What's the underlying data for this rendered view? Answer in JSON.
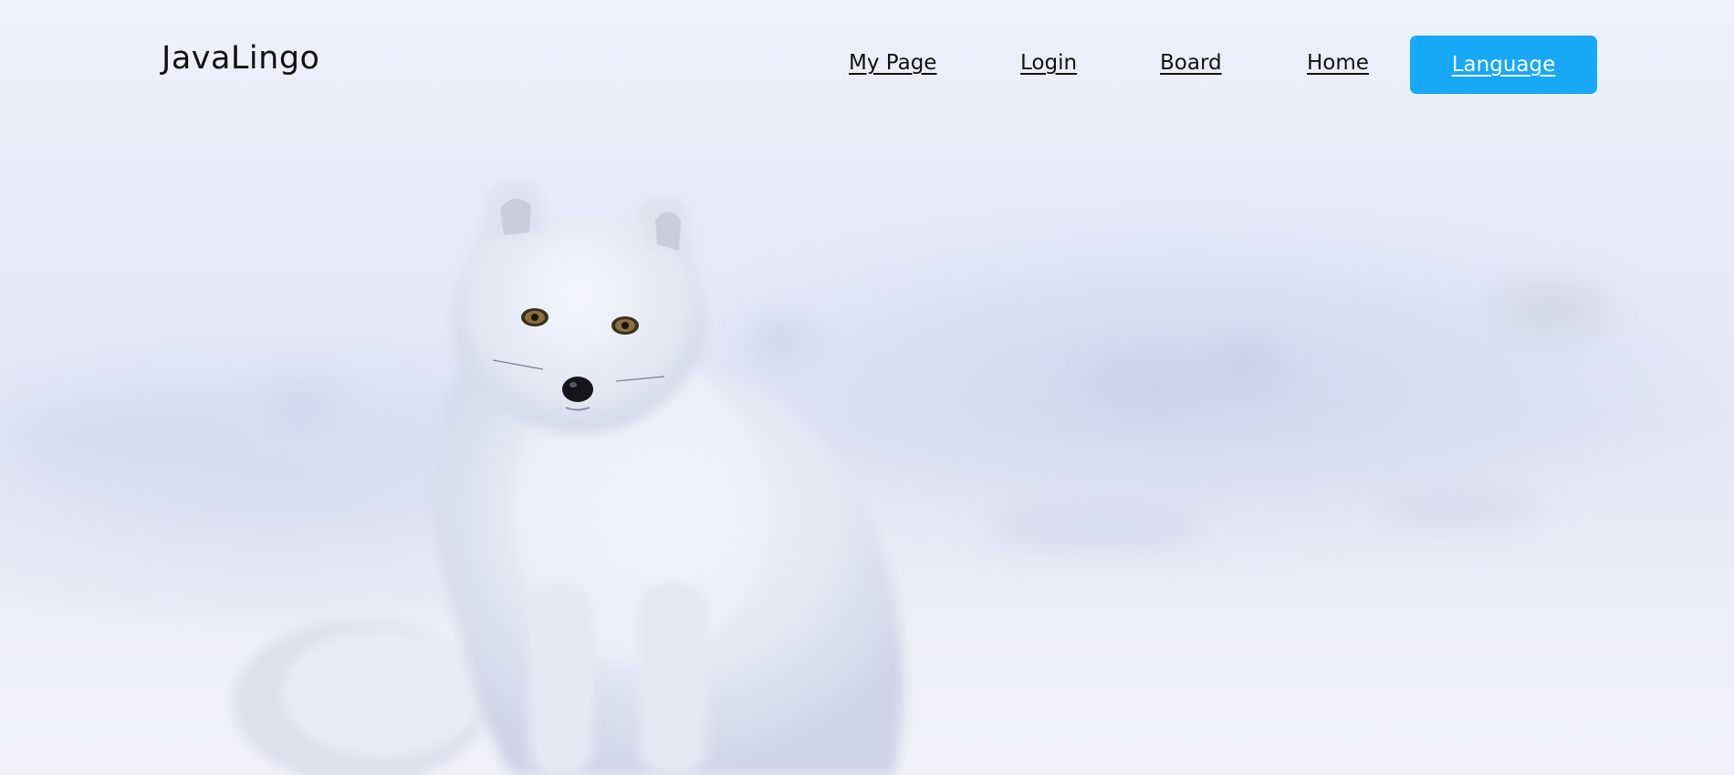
{
  "header": {
    "logo": "JavaLingo",
    "nav": {
      "my_page": "My Page",
      "login": "Login",
      "board": "Board",
      "home": "Home"
    },
    "language_button": "Language"
  },
  "colors": {
    "accent": "#18a9f6",
    "text": "#111111",
    "background": "#e6eafa"
  },
  "hero": {
    "image": "arctic-fox-in-snow"
  }
}
